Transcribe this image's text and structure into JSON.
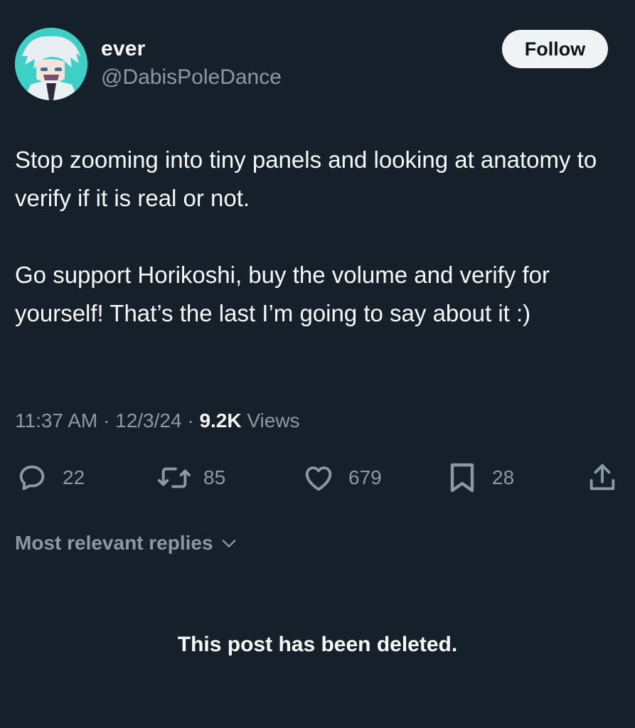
{
  "author": {
    "display_name": "ever",
    "handle": "@DabisPoleDance",
    "avatar": "anime-character-avatar"
  },
  "follow_label": "Follow",
  "post": {
    "paragraphs": [
      "Stop zooming into tiny panels and looking at anatomy to verify if it is real or not.",
      "Go support Horikoshi, buy the volume and verify for yourself! That’s the last I’m going to say about it :)"
    ],
    "time": "11:37 AM",
    "date": "12/3/24",
    "separator": "·",
    "views_count": "9.2K",
    "views_label": "Views"
  },
  "actions": {
    "replies": {
      "icon": "reply-icon",
      "count": "22"
    },
    "reposts": {
      "icon": "repost-icon",
      "count": "85"
    },
    "likes": {
      "icon": "heart-icon",
      "count": "679"
    },
    "bookmarks": {
      "icon": "bookmark-icon",
      "count": "28"
    },
    "share": {
      "icon": "share-icon"
    }
  },
  "replies_filter": {
    "label": "Most relevant replies",
    "icon": "chevron-down-icon"
  },
  "deleted_notice": "This post has been deleted.",
  "colors": {
    "background": "#15202b",
    "primary_text": "#f7f9f9",
    "secondary_text": "#8b98a5",
    "button_bg": "#eff3f4",
    "button_text": "#0f1419"
  }
}
